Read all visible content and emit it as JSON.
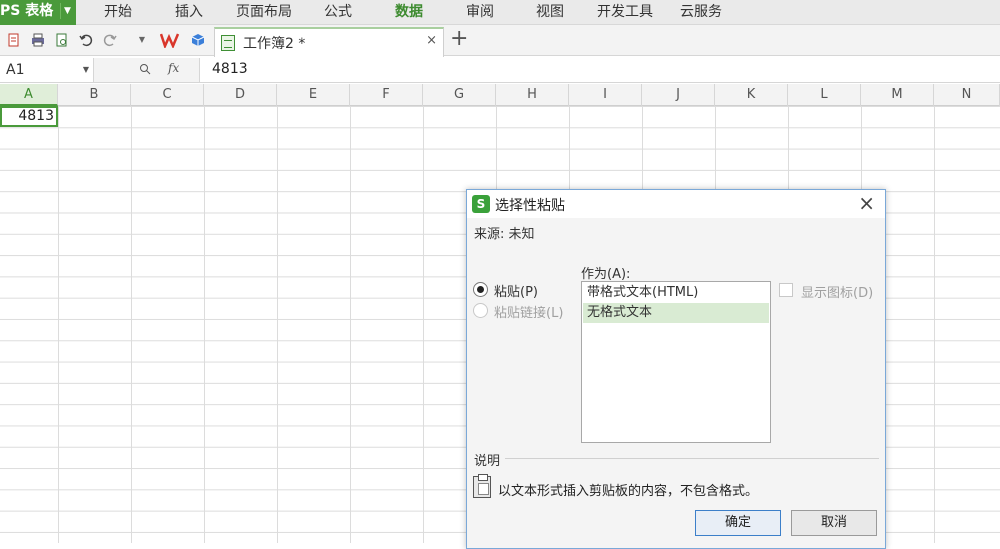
{
  "app": {
    "logo_label": "PS 表格",
    "logo_arrow": "▼"
  },
  "menu": {
    "items": [
      "开始",
      "插入",
      "页面布局",
      "公式",
      "数据",
      "审阅",
      "视图",
      "开发工具",
      "云服务"
    ],
    "active": "数据"
  },
  "toolbar": {
    "icons": [
      "new-doc-icon",
      "print-icon",
      "print-preview-icon",
      "undo-icon",
      "redo-icon",
      "dropdown-arrow-icon",
      "wps-logo-icon",
      "cloud-cube-icon"
    ]
  },
  "tabs": [
    {
      "title": "工作簿2 *",
      "close": "×"
    }
  ],
  "tab_add": "+",
  "formula_bar": {
    "cell_ref": "A1",
    "fx": "fx",
    "value": "4813"
  },
  "sheet": {
    "columns": [
      "A",
      "B",
      "C",
      "D",
      "E",
      "F",
      "G",
      "H",
      "I",
      "J",
      "K",
      "L",
      "M",
      "N"
    ],
    "selected_column": "A",
    "a1_value": "4813"
  },
  "dialog": {
    "title": "选择性粘贴",
    "close": "×",
    "source": "来源: 未知",
    "as_label": "作为(A):",
    "options": [
      {
        "label": "粘贴(P)",
        "checked": true,
        "enabled": true
      },
      {
        "label": "粘贴链接(L)",
        "checked": false,
        "enabled": false
      }
    ],
    "list": [
      {
        "label": "带格式文本(HTML)",
        "selected": false
      },
      {
        "label": "无格式文本",
        "selected": true
      }
    ],
    "show_icon_label": "显示图标(D)",
    "desc_label": "说明",
    "desc_text": "以文本形式插入剪贴板的内容，不包含格式。",
    "ok_label": "确定",
    "cancel_label": "取消"
  },
  "colors": {
    "brand_green": "#4a9a3b",
    "active_menu": "#3d8b2f",
    "selection_highlight": "#d9ebd3",
    "primary_button_border": "#3c7fc9"
  }
}
